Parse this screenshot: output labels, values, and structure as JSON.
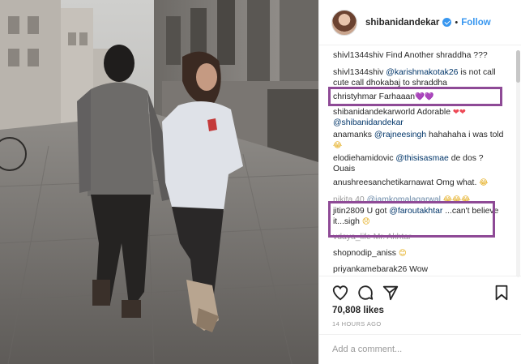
{
  "post": {
    "username": "shibanidandekar",
    "verified": true,
    "separator": "•",
    "follow_label": "Follow"
  },
  "comments": [
    {
      "user": "shivl1344shiv",
      "parts": [
        {
          "t": "text",
          "v": "Find Another shraddha ???"
        }
      ]
    },
    {
      "user": "shivl1344shiv",
      "parts": [
        {
          "t": "mention",
          "v": "@karishmakotak26"
        },
        {
          "t": "text",
          "v": " is not call cute call dhokabaj to shraddha"
        }
      ]
    },
    {
      "user": "christyhmar",
      "parts": [
        {
          "t": "text",
          "v": "Farhaaan"
        },
        {
          "t": "emoji",
          "v": "💜💜",
          "c": "purple"
        }
      ]
    },
    {
      "user": "shibanidandekarworld",
      "parts": [
        {
          "t": "text",
          "v": "Adorable "
        },
        {
          "t": "emoji",
          "v": "❤❤",
          "c": "heart"
        },
        {
          "t": "text",
          "v": " "
        },
        {
          "t": "mention",
          "v": "@shibanidandekar"
        }
      ]
    },
    {
      "user": "anamanks",
      "parts": [
        {
          "t": "mention",
          "v": "@rajneesingh"
        },
        {
          "t": "text",
          "v": " hahahaha i was told "
        },
        {
          "t": "emoji",
          "v": "😂",
          "c": "yellow"
        }
      ]
    },
    {
      "user": "elodiehamidovic",
      "parts": [
        {
          "t": "mention",
          "v": "@thisisasmae"
        },
        {
          "t": "text",
          "v": " de dos ? Ouais"
        }
      ]
    },
    {
      "user": "anushreesanchetikarnawat",
      "parts": [
        {
          "t": "text",
          "v": "Omg what. "
        },
        {
          "t": "emoji",
          "v": "😂",
          "c": "yellow"
        }
      ]
    },
    {
      "user": "nikita.40",
      "parts": [
        {
          "t": "mention",
          "v": "@iamkomalagarwal"
        },
        {
          "t": "text",
          "v": " "
        },
        {
          "t": "emoji",
          "v": "😂😂😂",
          "c": "yellow"
        }
      ]
    },
    {
      "user": "jitin2809",
      "parts": [
        {
          "t": "text",
          "v": "U got "
        },
        {
          "t": "mention",
          "v": "@faroutakhtar"
        },
        {
          "t": "text",
          "v": " ...can't believe it...sigh "
        },
        {
          "t": "emoji",
          "v": "😞",
          "c": "yellow"
        }
      ]
    },
    {
      "user": "vdaya_life",
      "parts": [
        {
          "t": "text",
          "v": "Mr. Akhtar"
        }
      ]
    },
    {
      "user": "shopnodip_aniss",
      "parts": [
        {
          "t": "emoji",
          "v": "😊",
          "c": "yellow"
        }
      ]
    },
    {
      "user": "priyankamebarak26",
      "parts": [
        {
          "t": "text",
          "v": "Wow"
        }
      ]
    }
  ],
  "likes_text": "70,808 likes",
  "time_text": "14 HOURS AGO",
  "add_comment_placeholder": "Add a comment...",
  "icons": {
    "like": "heart-outline-icon",
    "comment": "speech-bubble-icon",
    "share": "share-arrow-icon",
    "save": "bookmark-icon"
  },
  "colors": {
    "accent": "#3897f0",
    "highlight_box": "#8e4a96",
    "mention": "#003569"
  }
}
